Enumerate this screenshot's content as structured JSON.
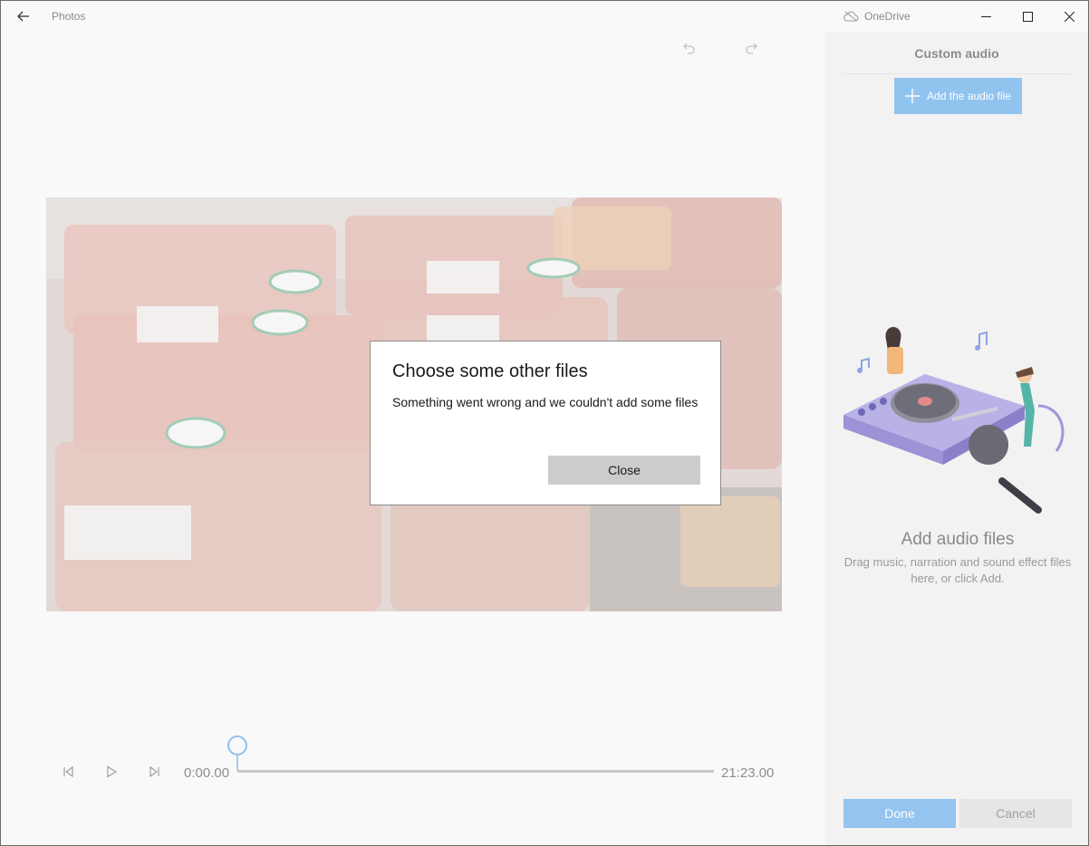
{
  "titlebar": {
    "app_title": "Photos",
    "onedrive_label": "OneDrive",
    "icons": {
      "back": "back-arrow-icon",
      "cloud": "cloud-off-icon",
      "minimize": "minimize-icon",
      "maximize": "maximize-icon",
      "close": "close-icon"
    }
  },
  "editor": {
    "icons": {
      "undo": "undo-icon",
      "redo": "redo-icon"
    }
  },
  "playback": {
    "current_time": "0:00.00",
    "total_time": "21:23.00",
    "position_fraction": 0,
    "icons": {
      "prev": "step-back-icon",
      "play": "play-icon",
      "next": "step-forward-icon"
    }
  },
  "panel": {
    "title": "Custom audio",
    "add_button_label": "Add the audio file",
    "empty_title": "Add audio files",
    "empty_description": "Drag music, narration and sound effect files here, or click Add.",
    "done_label": "Done",
    "cancel_label": "Cancel",
    "accent_color": "#91c3ef"
  },
  "dialog": {
    "title": "Choose some other files",
    "message": "Something went wrong and we couldn't add some files",
    "close_label": "Close"
  }
}
